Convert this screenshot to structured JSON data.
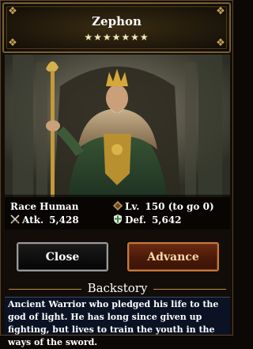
{
  "hero": {
    "name": "Zephon",
    "stars": "★★★★★★★",
    "star_count": 7
  },
  "stats": {
    "race_label": "Race",
    "race_value": "Human",
    "level_label": "Lv.",
    "level_value": "150 (to go 0)",
    "attack_label": "Atk.",
    "attack_value": "5,428",
    "defense_label": "Def.",
    "defense_value": "5,642"
  },
  "buttons": {
    "close_label": "Close",
    "advance_label": "Advance"
  },
  "backstory": {
    "title": "Backstory",
    "text": "Ancient Warrior who pledged his life to the god of light. He has long since given up fighting, but lives to train the youth in the ways of the sword."
  },
  "icons": {
    "level": "diamond-icon",
    "attack": "crossed-swords-icon",
    "defense": "shield-icon"
  },
  "colors": {
    "frame_gold": "#7a6030",
    "advance_border": "#c27a3c",
    "close_border": "#9a9a9a",
    "story_bg": "#0a1224"
  }
}
